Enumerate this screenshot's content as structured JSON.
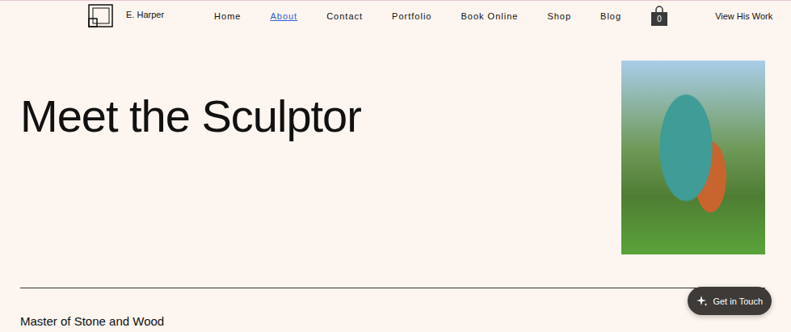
{
  "brand": {
    "name": "E. Harper"
  },
  "nav": [
    {
      "label": "Home",
      "selected": false
    },
    {
      "label": "About",
      "selected": true
    },
    {
      "label": "Contact",
      "selected": false
    },
    {
      "label": "Portfolio",
      "selected": false
    },
    {
      "label": "Book Online",
      "selected": false
    },
    {
      "label": "Shop",
      "selected": false
    },
    {
      "label": "Blog",
      "selected": false
    }
  ],
  "cart": {
    "count": "0"
  },
  "cta": {
    "label": "View His Work"
  },
  "hero": {
    "title": "Meet the Sculptor"
  },
  "section": {
    "subtitle": "Master of Stone and Wood"
  },
  "chat": {
    "label": "Get in Touch"
  }
}
